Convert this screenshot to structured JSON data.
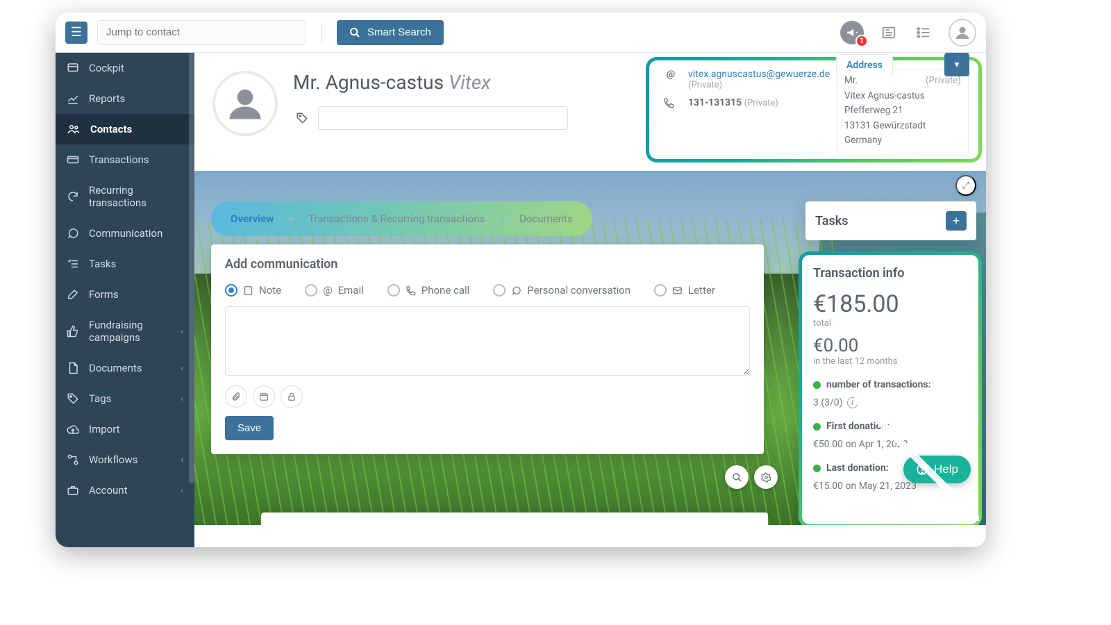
{
  "topbar": {
    "jump_placeholder": "Jump to contact",
    "smart_search": "Smart Search",
    "notification_count": "1"
  },
  "sidebar": {
    "items": [
      {
        "label": "Cockpit"
      },
      {
        "label": "Reports"
      },
      {
        "label": "Contacts"
      },
      {
        "label": "Transactions"
      },
      {
        "label": "Recurring transactions"
      },
      {
        "label": "Communication"
      },
      {
        "label": "Tasks"
      },
      {
        "label": "Forms"
      },
      {
        "label": "Fundraising campaigns"
      },
      {
        "label": "Documents"
      },
      {
        "label": "Tags"
      },
      {
        "label": "Import"
      },
      {
        "label": "Workflows"
      },
      {
        "label": "Account"
      }
    ]
  },
  "contact": {
    "salutation": "Mr.",
    "first": "Agnus-castus",
    "last": "Vitex",
    "email": "vitex.agnuscastus@gewuerze.de",
    "email_scope": "(Private)",
    "phone": "131-131315",
    "phone_scope": "(Private)",
    "address": {
      "tab": "Address",
      "scope": "(Private)",
      "line0": "Mr.",
      "line1": "Vitex Agnus-castus",
      "line2": "Pfefferweg 21",
      "line3": "13131 Gewürzstadt",
      "line4": "Germany"
    }
  },
  "tabs": {
    "t1": "Overview",
    "t2": "Transactions & Recurring transactions",
    "t3": "Documents"
  },
  "comm": {
    "title": "Add communication",
    "opts": {
      "note": "Note",
      "email": "Email",
      "phone": "Phone call",
      "personal": "Personal conversation",
      "letter": "Letter"
    },
    "save": "Save"
  },
  "tasks": {
    "title": "Tasks"
  },
  "txinfo": {
    "title": "Transaction info",
    "total_amount": "€185.00",
    "total_label": "total",
    "last12_amount": "€0.00",
    "last12_label": "in the last 12 months",
    "count_label": "number of transactions:",
    "count_value": "3  (3/0)",
    "first_label": "First donation:",
    "first_value": "€50.00 on Apr 1, 2023",
    "last_label": "Last donation:",
    "last_value": "€15.00 on May 21, 2023"
  },
  "help": "Help"
}
